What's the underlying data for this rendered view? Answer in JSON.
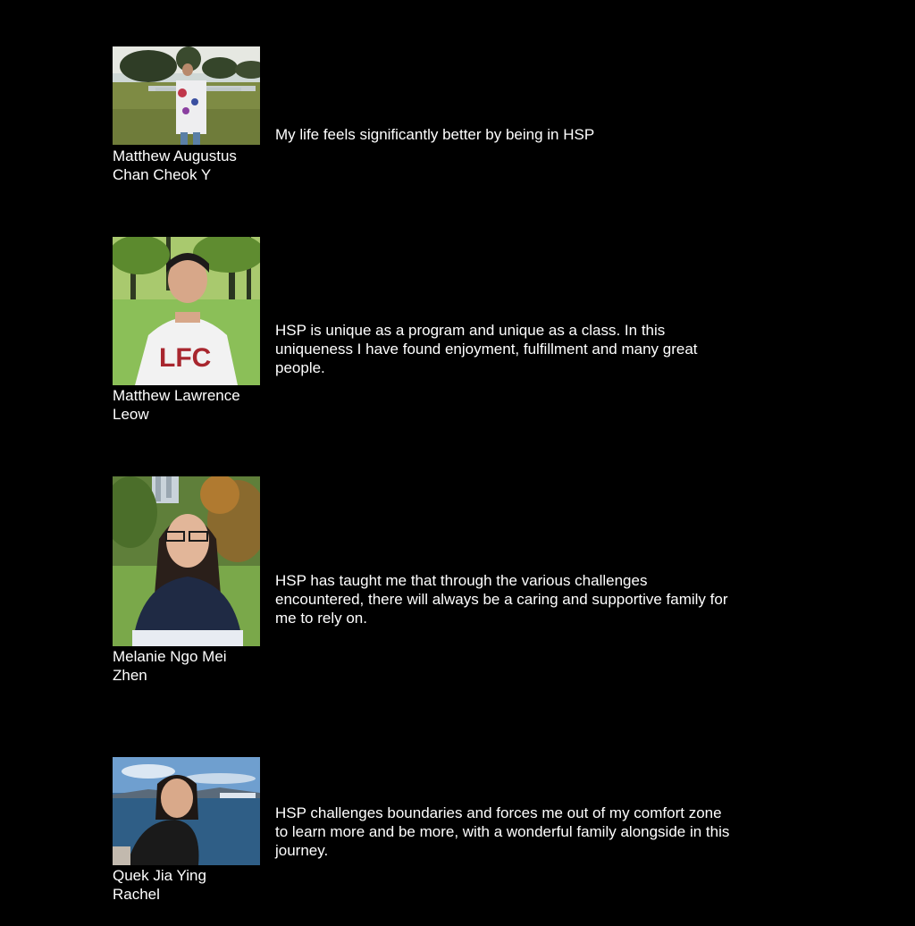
{
  "testimonials": [
    {
      "name_line1": "Matthew Augustus",
      "name_line2": "Chan Cheok Y",
      "quote": "My life feels significantly better by being in HSP"
    },
    {
      "name_line1": "Matthew Lawrence",
      "name_line2": "Leow",
      "quote": "HSP is unique as a program and unique as a class. In this uniqueness I have found enjoyment, fulfillment and many great people."
    },
    {
      "name_line1": "Melanie Ngo Mei",
      "name_line2": "Zhen",
      "quote": "HSP has taught me that through the various challenges encountered, there will always be a caring and supportive family for me to rely on."
    },
    {
      "name_line1": "Quek Jia Ying",
      "name_line2": "Rachel",
      "quote": "HSP challenges boundaries and forces me out of my comfort zone to learn more and be more, with a wonderful family alongside in this journey."
    }
  ],
  "colors": {
    "background": "#000000",
    "text": "#ffffff"
  }
}
